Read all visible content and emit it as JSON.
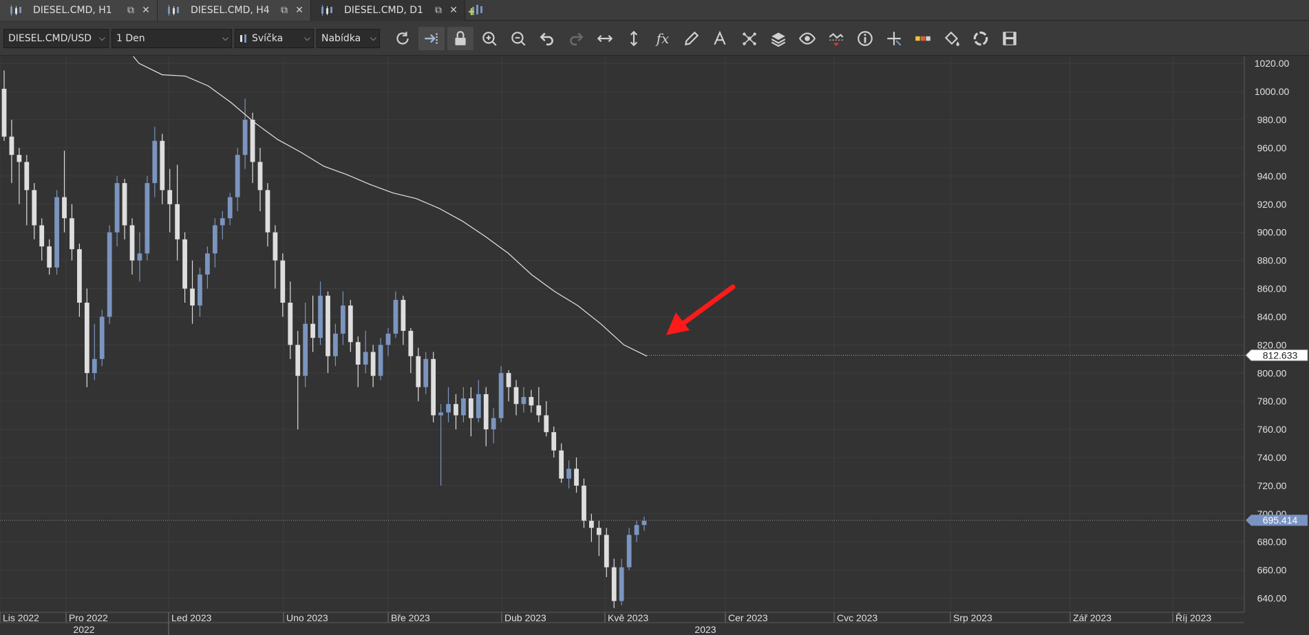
{
  "tabs": [
    {
      "label": "DIESEL.CMD, H1",
      "active": false
    },
    {
      "label": "DIESEL.CMD, H4",
      "active": false
    },
    {
      "label": "DIESEL.CMD, D1",
      "active": true
    }
  ],
  "toolbar": {
    "instrument": "DIESEL.CMD/USD",
    "period": "1 Den",
    "chart_type": "Svíčka",
    "price_side": "Nabídka",
    "tools": [
      "refresh-icon",
      "shift-chart-icon",
      "lock-icon",
      "zoom-in-icon",
      "zoom-out-icon",
      "undo-icon",
      "redo-icon",
      "horizontal-scale-icon",
      "vertical-scale-icon",
      "fx-icon",
      "pencil-icon",
      "text-tool-icon",
      "pattern-icon",
      "layers-icon",
      "eye-icon",
      "alert-icon",
      "info-icon",
      "crosshair-icon",
      "volume-bar-icon",
      "bucket-icon",
      "sync-icon",
      "save-icon"
    ],
    "fx_label": "fx"
  },
  "colors": {
    "background": "#333333",
    "bull_candle": "#7b95bf",
    "bear_candle": "#dedede",
    "ma_line": "#e6e6e6",
    "arrow": "#ff1a1a",
    "current_price_tag": "#7a93c2"
  },
  "chart_data": {
    "type": "candlestick",
    "symbol": "DIESEL.CMD/USD",
    "timeframe": "D1",
    "y_axis": {
      "min": 630,
      "max": 1025,
      "ticks": [
        "1020.00",
        "1000.00",
        "980.00",
        "960.00",
        "940.00",
        "920.00",
        "900.00",
        "880.00",
        "860.00",
        "840.00",
        "820.00",
        "800.00",
        "780.00",
        "760.00",
        "740.00",
        "720.00",
        "700.00",
        "680.00",
        "660.00",
        "640.00"
      ]
    },
    "x_axis": {
      "months": [
        "Lis 2022",
        "Pro 2022",
        "Led 2023",
        "Uno 2023",
        "Bře 2023",
        "Dub 2023",
        "Kvě 2023",
        "Cer 2023",
        "Cvc 2023",
        "Srp 2023",
        "Zář 2023",
        "Říj 2023"
      ],
      "years": [
        "2022",
        "2023"
      ]
    },
    "ma_last_value": "812.633",
    "current_price": "695.414",
    "ma_line": [
      1060,
      1040,
      1020,
      1012,
      1011,
      1004,
      992,
      978,
      966,
      957,
      947,
      941,
      934,
      928,
      924,
      917,
      908,
      897,
      885,
      870,
      858,
      848,
      835,
      820,
      812
    ],
    "candles": [
      [
        1002,
        1015,
        965,
        968
      ],
      [
        968,
        980,
        935,
        955
      ],
      [
        955,
        960,
        920,
        950
      ],
      [
        950,
        955,
        905,
        930
      ],
      [
        930,
        935,
        895,
        905
      ],
      [
        905,
        910,
        880,
        890
      ],
      [
        890,
        895,
        870,
        875
      ],
      [
        875,
        930,
        870,
        925
      ],
      [
        925,
        958,
        900,
        910
      ],
      [
        910,
        920,
        880,
        888
      ],
      [
        888,
        892,
        840,
        850
      ],
      [
        850,
        860,
        790,
        800
      ],
      [
        800,
        835,
        795,
        810
      ],
      [
        810,
        845,
        805,
        840
      ],
      [
        840,
        905,
        835,
        900
      ],
      [
        900,
        940,
        890,
        935
      ],
      [
        935,
        938,
        895,
        905
      ],
      [
        905,
        910,
        870,
        880
      ],
      [
        880,
        900,
        865,
        885
      ],
      [
        885,
        940,
        880,
        935
      ],
      [
        935,
        975,
        925,
        965
      ],
      [
        965,
        970,
        920,
        930
      ],
      [
        930,
        945,
        900,
        920
      ],
      [
        920,
        948,
        880,
        895
      ],
      [
        895,
        900,
        850,
        860
      ],
      [
        860,
        880,
        835,
        848
      ],
      [
        848,
        875,
        840,
        870
      ],
      [
        870,
        890,
        860,
        885
      ],
      [
        885,
        910,
        875,
        905
      ],
      [
        905,
        915,
        895,
        910
      ],
      [
        910,
        928,
        905,
        925
      ],
      [
        925,
        960,
        915,
        955
      ],
      [
        955,
        995,
        945,
        980
      ],
      [
        980,
        985,
        935,
        950
      ],
      [
        950,
        960,
        915,
        930
      ],
      [
        930,
        935,
        890,
        900
      ],
      [
        900,
        905,
        860,
        880
      ],
      [
        880,
        885,
        840,
        850
      ],
      [
        850,
        865,
        810,
        820
      ],
      [
        820,
        830,
        760,
        798
      ],
      [
        798,
        850,
        790,
        835
      ],
      [
        835,
        855,
        815,
        825
      ],
      [
        825,
        865,
        820,
        855
      ],
      [
        855,
        858,
        800,
        812
      ],
      [
        812,
        835,
        805,
        828
      ],
      [
        828,
        858,
        820,
        848
      ],
      [
        848,
        852,
        815,
        822
      ],
      [
        822,
        826,
        790,
        806
      ],
      [
        806,
        830,
        800,
        815
      ],
      [
        815,
        820,
        790,
        798
      ],
      [
        798,
        825,
        795,
        820
      ],
      [
        820,
        832,
        812,
        828
      ],
      [
        828,
        858,
        825,
        852
      ],
      [
        852,
        855,
        820,
        830
      ],
      [
        830,
        832,
        800,
        812
      ],
      [
        812,
        818,
        780,
        790
      ],
      [
        790,
        815,
        785,
        810
      ],
      [
        810,
        815,
        765,
        770
      ],
      [
        770,
        778,
        720,
        772
      ],
      [
        772,
        790,
        765,
        778
      ],
      [
        778,
        785,
        760,
        770
      ],
      [
        770,
        790,
        765,
        782
      ],
      [
        782,
        790,
        755,
        768
      ],
      [
        768,
        795,
        765,
        785
      ],
      [
        785,
        790,
        748,
        760
      ],
      [
        760,
        775,
        750,
        768
      ],
      [
        768,
        805,
        765,
        800
      ],
      [
        800,
        802,
        780,
        790
      ],
      [
        790,
        795,
        770,
        778
      ],
      [
        778,
        790,
        772,
        783
      ],
      [
        783,
        788,
        772,
        777
      ],
      [
        777,
        790,
        765,
        770
      ],
      [
        770,
        780,
        755,
        758
      ],
      [
        758,
        762,
        740,
        745
      ],
      [
        745,
        750,
        722,
        725
      ],
      [
        725,
        738,
        718,
        732
      ],
      [
        732,
        740,
        715,
        720
      ],
      [
        720,
        725,
        690,
        695
      ],
      [
        695,
        700,
        680,
        690
      ],
      [
        690,
        695,
        670,
        685
      ],
      [
        685,
        690,
        655,
        662
      ],
      [
        662,
        668,
        633,
        638
      ],
      [
        638,
        668,
        635,
        662
      ],
      [
        662,
        690,
        660,
        685
      ],
      [
        685,
        695,
        680,
        692
      ],
      [
        692,
        698,
        688,
        695
      ]
    ]
  }
}
